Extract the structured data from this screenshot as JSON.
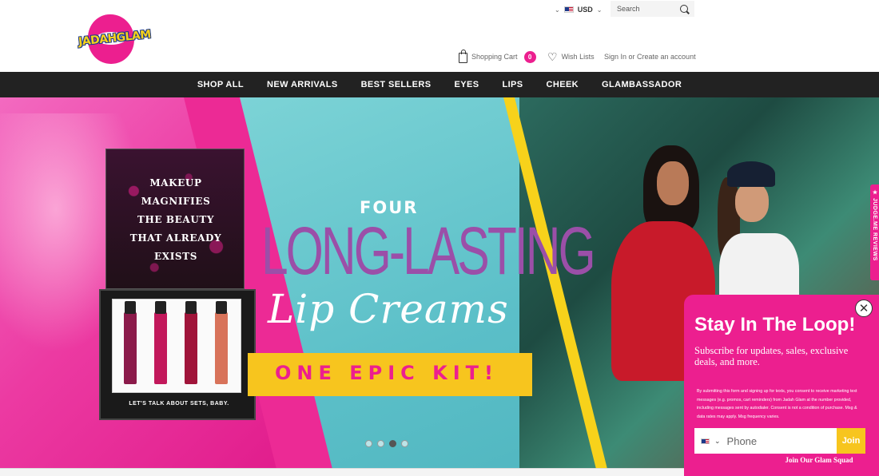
{
  "logo": {
    "text": "JADAHGLAM"
  },
  "topbar": {
    "currency": "USD",
    "search_placeholder": "Search"
  },
  "header": {
    "cart_label": "Shopping Cart",
    "cart_count": "0",
    "wishlist_label": "Wish Lists",
    "account_text": "Sign In or Create an account"
  },
  "nav": {
    "items": [
      "SHOP ALL",
      "NEW ARRIVALS",
      "BEST SELLERS",
      "EYES",
      "LIPS",
      "CHEEK",
      "GLAMBASSADOR"
    ]
  },
  "hero": {
    "kit_quote": [
      "MAKEUP",
      "MAGNIFIES",
      "THE BEAUTY",
      "THAT ALREADY",
      "EXISTS"
    ],
    "kit_tag": "LET'S TALK ABOUT SETS, BABY.",
    "tube_colors": [
      "#8b1a4a",
      "#c2185b",
      "#a0143a",
      "#d8735a"
    ],
    "headline_small": "FOUR",
    "headline_big": "LONG-LASTING",
    "headline_script": "Lip Creams",
    "banner_text": "ONE EPIC KIT!",
    "slide_count": 4,
    "active_slide": 3
  },
  "reviews_tab": {
    "label": "★ JUDGE.ME REVIEWS"
  },
  "popup": {
    "title": "Stay In The Loop!",
    "subtitle": "Subscribe for updates, sales, exclusive deals, and more.",
    "legal": "By submitting this form and signing up for texts, you consent to receive marketing text messages (e.g. promos, cart reminders) from Jadah Glam at the number provided, including messages sent by autodialer. Consent is not a condition of purchase. Msg & data rates may apply. Msg frequency varies.",
    "phone_placeholder": "Phone",
    "join_label": "Join",
    "squad_text": "Join Our Glam Squad"
  },
  "colors": {
    "brand_pink": "#ec1f8f",
    "nav_bg": "#222222",
    "accent_yellow": "#f7c51e",
    "headline_purple": "#9b4fa8",
    "teal": "#5fbfc8"
  }
}
